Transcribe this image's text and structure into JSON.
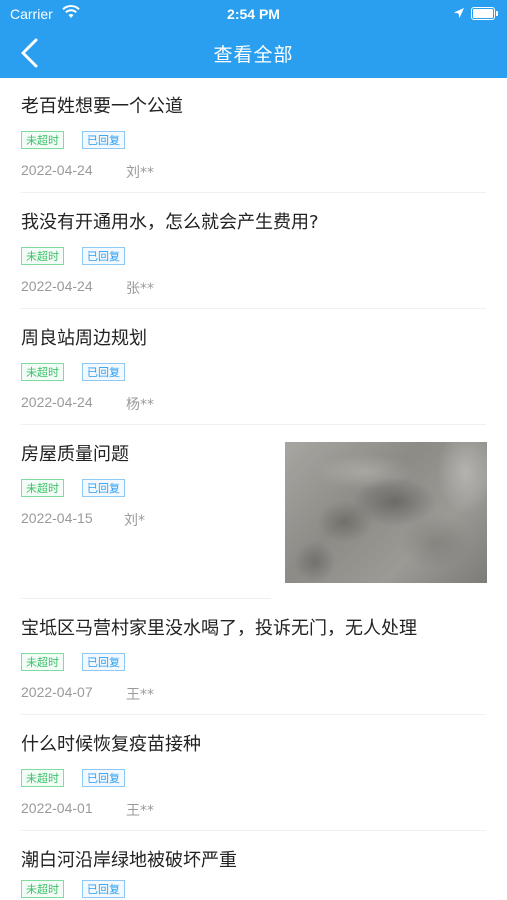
{
  "status_bar": {
    "carrier": "Carrier",
    "time": "2:54 PM"
  },
  "nav": {
    "title": "查看全部"
  },
  "tags": {
    "not_overdue": "未超时",
    "replied": "已回复"
  },
  "items": [
    {
      "title": "老百姓想要一个公道",
      "date": "2022-04-24",
      "name": "刘**"
    },
    {
      "title": "我没有开通用水，怎么就会产生费用?",
      "date": "2022-04-24",
      "name": "张**"
    },
    {
      "title": "周良站周边规划",
      "date": "2022-04-24",
      "name": "杨**"
    },
    {
      "title": "房屋质量问题",
      "date": "2022-04-15",
      "name": "刘*",
      "has_image": true
    },
    {
      "title": "宝坻区马营村家里没水喝了，投诉无门，无人处理",
      "date": "2022-04-07",
      "name": "王**"
    },
    {
      "title": "什么时候恢复疫苗接种",
      "date": "2022-04-01",
      "name": "王**"
    },
    {
      "title": "潮白河沿岸绿地被破坏严重",
      "date": "",
      "name": ""
    }
  ],
  "colors": {
    "primary": "#2a9ff0",
    "tag_green": "#3cc06a",
    "tag_blue": "#2a9ff0",
    "meta_gray": "#9a9a9a"
  }
}
